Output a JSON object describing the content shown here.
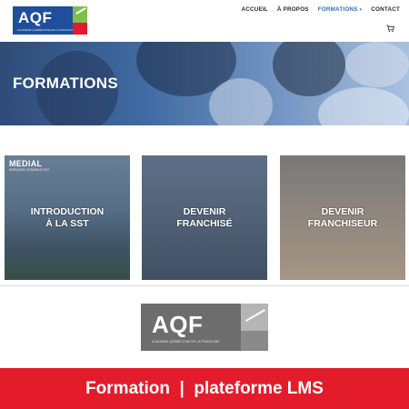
{
  "header": {
    "logo_text": "AQF",
    "logo_subtitle": "ACADÉMIE QUÉBÉCOISE DE LA FRANCHISE",
    "nav": [
      {
        "label": "ACCUEIL"
      },
      {
        "label": "À PROPOS"
      },
      {
        "label": "FORMATIONS"
      },
      {
        "label": "CONTACT"
      }
    ],
    "cart_icon": "cart-icon"
  },
  "banner": {
    "title": "FORMATIONS"
  },
  "cards": [
    {
      "label_line1": "INTRODUCTION",
      "label_line2": "À LA SST",
      "brand": "MEDIAL",
      "brand_sub": "SERVICES CONSEILS SST"
    },
    {
      "label_line1": "DEVENIR",
      "label_line2": "FRANCHISÉ"
    },
    {
      "label_line1": "DEVENIR",
      "label_line2": "FRANCHISEUR"
    }
  ],
  "grey_logo": {
    "text": "AQF",
    "subtitle": "ACADÉMIE QUÉBÉCOISE DE LA FRANCHISE"
  },
  "footer": {
    "text": "Formation  |  plateforme LMS"
  },
  "colors": {
    "brand_blue": "#1f4f9c",
    "accent_red": "#e31b2a",
    "accent_green": "#7fbf4a",
    "nav_active": "#2c6fb7"
  }
}
